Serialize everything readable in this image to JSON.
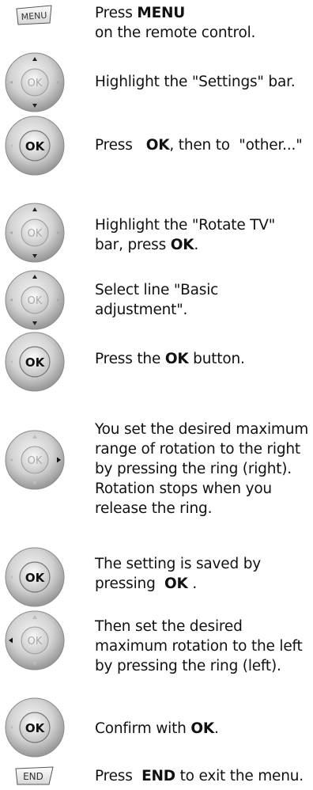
{
  "steps": [
    {
      "icon": "menu-key-icon",
      "pre": "Press ",
      "bold": "MENU",
      "post": " on the remote control."
    },
    {
      "icon": "navigation-ring-icon",
      "pre": "Highlight the \"Settings\" bar.",
      "bold": "",
      "post": ""
    },
    {
      "icon": "ok-button-icon",
      "pre": "Press   ",
      "bold": "OK",
      "post": ", then to  \"other...\""
    },
    {
      "icon": "navigation-ring-icon",
      "pre": "Highlight the \"Rotate TV\" bar, press ",
      "bold": "OK",
      "post": "."
    },
    {
      "icon": "navigation-ring-icon",
      "pre": "Select line \"Basic adjustment\".",
      "bold": "",
      "post": ""
    },
    {
      "icon": "ok-button-icon",
      "pre": "Press the ",
      "bold": "OK",
      "post": " button."
    },
    {
      "icon": "navigation-ring-right-icon",
      "pre": "You set the desired maximum range of rotation to the right by pressing the ring (right). Rotation stops when you release the ring.",
      "bold": "",
      "post": ""
    },
    {
      "icon": "ok-button-icon",
      "pre": "The setting is saved by pressing  ",
      "bold": "OK",
      "post": " ."
    },
    {
      "icon": "navigation-ring-left-icon",
      "pre": "Then set the desired maximum rotation to the left by pressing the ring (left).",
      "bold": "",
      "post": ""
    },
    {
      "icon": "ok-button-icon",
      "pre": "Confirm with ",
      "bold": "OK",
      "post": "."
    },
    {
      "icon": "end-key-icon",
      "pre": "Press  ",
      "bold": "END",
      "post": " to exit the menu."
    }
  ],
  "icon_labels": {
    "menu": "MENU",
    "end": "END",
    "ok": "OK"
  }
}
